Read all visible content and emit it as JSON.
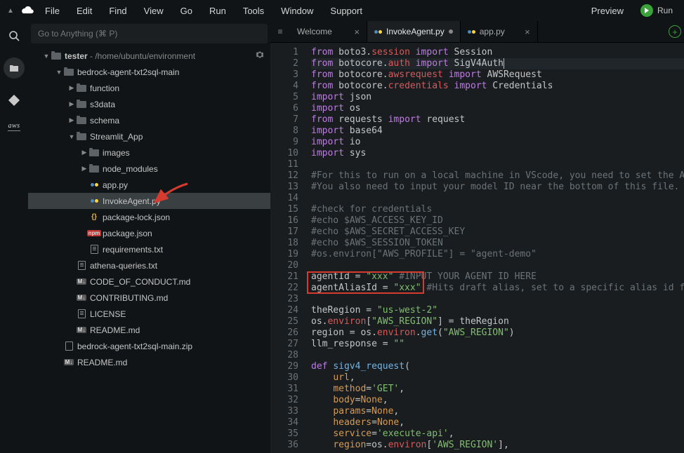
{
  "menubar": {
    "items": [
      "File",
      "Edit",
      "Find",
      "View",
      "Go",
      "Run",
      "Tools",
      "Window",
      "Support"
    ],
    "preview": "Preview",
    "run": "Run"
  },
  "goto": {
    "placeholder": "Go to Anything (⌘ P)"
  },
  "tree": {
    "root_name": "tester",
    "root_path": " - /home/ubuntu/environment",
    "nodes": [
      {
        "d": 2,
        "t": "folder",
        "open": true,
        "label": "bedrock-agent-txt2sql-main"
      },
      {
        "d": 3,
        "t": "folder",
        "open": false,
        "label": "function"
      },
      {
        "d": 3,
        "t": "folder",
        "open": false,
        "label": "s3data"
      },
      {
        "d": 3,
        "t": "folder",
        "open": false,
        "label": "schema"
      },
      {
        "d": 3,
        "t": "folder",
        "open": true,
        "label": "Streamlit_App"
      },
      {
        "d": 4,
        "t": "folder",
        "open": false,
        "label": "images"
      },
      {
        "d": 4,
        "t": "folder",
        "open": false,
        "label": "node_modules"
      },
      {
        "d": 4,
        "t": "py",
        "label": "app.py"
      },
      {
        "d": 4,
        "t": "py",
        "label": "InvokeAgent.py",
        "sel": true
      },
      {
        "d": 4,
        "t": "json",
        "label": "package-lock.json"
      },
      {
        "d": 4,
        "t": "npm",
        "label": "package.json"
      },
      {
        "d": 4,
        "t": "txt",
        "label": "requirements.txt"
      },
      {
        "d": 3,
        "t": "txt",
        "label": "athena-queries.txt"
      },
      {
        "d": 3,
        "t": "md",
        "label": "CODE_OF_CONDUCT.md"
      },
      {
        "d": 3,
        "t": "md",
        "label": "CONTRIBUTING.md"
      },
      {
        "d": 3,
        "t": "txt",
        "label": "LICENSE"
      },
      {
        "d": 3,
        "t": "md",
        "label": "README.md"
      },
      {
        "d": 2,
        "t": "zip",
        "label": "bedrock-agent-txt2sql-main.zip"
      },
      {
        "d": 2,
        "t": "md",
        "label": "README.md"
      }
    ]
  },
  "tabs": [
    {
      "label": "Welcome",
      "icon": "none",
      "close": true
    },
    {
      "label": "InvokeAgent.py",
      "icon": "py",
      "active": true,
      "dirty": true
    },
    {
      "label": "app.py",
      "icon": "py",
      "close": true
    }
  ],
  "code": {
    "lines": [
      {
        "n": 1,
        "hl": false,
        "h": "<span class='kw'>from</span> boto3.<span class='attr'>session</span> <span class='kw'>import</span> Session"
      },
      {
        "n": 2,
        "hl": true,
        "h": "<span class='kw'>from</span> botocore.<span class='attr'>auth</span> <span class='kw'>import</span> SigV4Auth<span style='border-left:1px solid #bbb'></span>"
      },
      {
        "n": 3,
        "hl": false,
        "h": "<span class='kw'>from</span> botocore.<span class='attr'>awsrequest</span> <span class='kw'>import</span> AWSRequest"
      },
      {
        "n": 4,
        "hl": false,
        "h": "<span class='kw'>from</span> botocore.<span class='attr'>credentials</span> <span class='kw'>import</span> Credentials"
      },
      {
        "n": 5,
        "hl": false,
        "h": "<span class='kw'>import</span> json"
      },
      {
        "n": 6,
        "hl": false,
        "h": "<span class='kw'>import</span> os"
      },
      {
        "n": 7,
        "hl": false,
        "h": "<span class='kw'>from</span> requests <span class='kw'>import</span> request"
      },
      {
        "n": 8,
        "hl": false,
        "h": "<span class='kw'>import</span> base64"
      },
      {
        "n": 9,
        "hl": false,
        "h": "<span class='kw'>import</span> io"
      },
      {
        "n": 10,
        "hl": false,
        "h": "<span class='kw'>import</span> sys"
      },
      {
        "n": 11,
        "hl": false,
        "h": ""
      },
      {
        "n": 12,
        "hl": false,
        "h": "<span class='cmt'>#For this to run on a local machine in VScode, you need to set the AWS_PR</span>"
      },
      {
        "n": 13,
        "hl": false,
        "h": "<span class='cmt'>#You also need to input your model ID near the bottom of this file.</span>"
      },
      {
        "n": 14,
        "hl": false,
        "h": ""
      },
      {
        "n": 15,
        "hl": false,
        "h": "<span class='cmt'>#check for credentials</span>"
      },
      {
        "n": 16,
        "hl": false,
        "h": "<span class='cmt'>#echo $AWS_ACCESS_KEY_ID</span>"
      },
      {
        "n": 17,
        "hl": false,
        "h": "<span class='cmt'>#echo $AWS_SECRET_ACCESS_KEY</span>"
      },
      {
        "n": 18,
        "hl": false,
        "h": "<span class='cmt'>#echo $AWS_SESSION_TOKEN</span>"
      },
      {
        "n": 19,
        "hl": false,
        "h": "<span class='cmt'>#os.environ[\"AWS_PROFILE\"] = \"agent-demo\"</span>"
      },
      {
        "n": 20,
        "hl": false,
        "h": ""
      },
      {
        "n": 21,
        "hl": false,
        "h": "agentId = <span class='str'>\"xxx\"</span> <span class='cmt'>#INPUT YOUR AGENT ID HERE</span>",
        "box": true
      },
      {
        "n": 22,
        "hl": false,
        "h": "agentAliasId = <span class='str'>\"xxx\"</span> <span class='cmt'>#Hits draft alias, set to a specific alias id for a</span>"
      },
      {
        "n": 23,
        "hl": false,
        "h": ""
      },
      {
        "n": 24,
        "hl": false,
        "h": "theRegion = <span class='str'>\"us-west-2\"</span>"
      },
      {
        "n": 25,
        "hl": false,
        "h": "os.<span class='attr'>environ</span>[<span class='str'>\"AWS_REGION\"</span>] = theRegion"
      },
      {
        "n": 26,
        "hl": false,
        "h": "region = os.<span class='attr'>environ</span>.<span class='name'>get</span>(<span class='str'>\"AWS_REGION\"</span>)"
      },
      {
        "n": 27,
        "hl": false,
        "h": "llm_response = <span class='str'>\"\"</span>"
      },
      {
        "n": 28,
        "hl": false,
        "h": ""
      },
      {
        "n": 29,
        "hl": false,
        "h": "<span class='kw'>def</span> <span class='name'>sigv4_request</span>("
      },
      {
        "n": 30,
        "hl": false,
        "h": "    <span class='param'>url</span>,"
      },
      {
        "n": 31,
        "hl": false,
        "h": "    <span class='param'>method</span>=<span class='str'>'GET'</span>,"
      },
      {
        "n": 32,
        "hl": false,
        "h": "    <span class='param'>body</span>=<span class='param'>None</span>,"
      },
      {
        "n": 33,
        "hl": false,
        "h": "    <span class='param'>params</span>=<span class='param'>None</span>,"
      },
      {
        "n": 34,
        "hl": false,
        "h": "    <span class='param'>headers</span>=<span class='param'>None</span>,"
      },
      {
        "n": 35,
        "hl": false,
        "h": "    <span class='param'>service</span>=<span class='str'>'execute-api'</span>,"
      },
      {
        "n": 36,
        "hl": false,
        "h": "    <span class='param'>region</span>=os.<span class='attr'>environ</span>[<span class='str'>'AWS_REGION'</span>],"
      }
    ]
  }
}
